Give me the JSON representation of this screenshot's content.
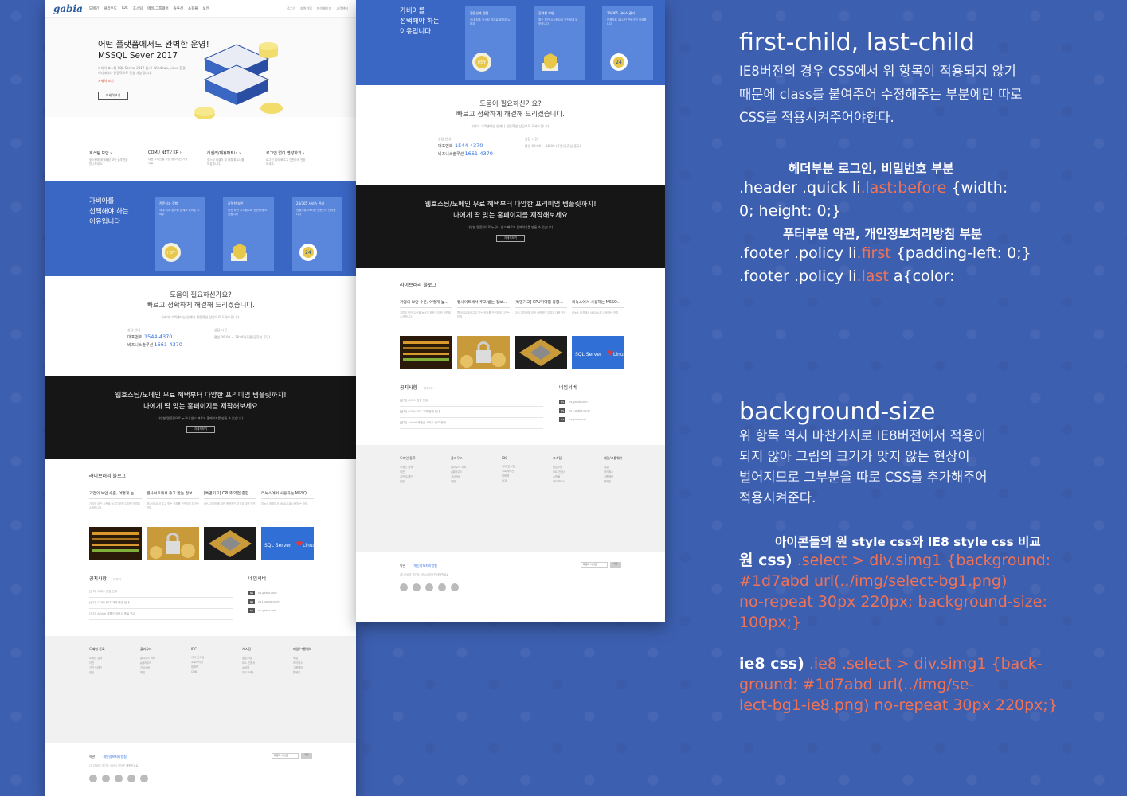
{
  "site": {
    "logo": "gabia",
    "nav": [
      "도메인",
      "클라우드",
      "IDC",
      "호스팅",
      "메일/그룹웨어",
      "솔루션",
      "쇼핑몰",
      "보안"
    ],
    "quick": [
      "로그인",
      "회원가입",
      "마이페이지",
      "고객센터"
    ]
  },
  "hero": {
    "title_line1": "어떤 플랫폼에서도 완벽한 운영!",
    "title_line2": "MSSQL Sever 2017",
    "desc": "가비아 호스팅 SQL Server 2017 출시! Windows, Linux 환경 어디에서나 안정적으로 운영 가능합니다.",
    "link": "자세히 보기",
    "button": "자세히보기"
  },
  "quickmenu": [
    {
      "title": "호스팅 보안 ›",
      "desc": "호스팅에 최적화된 보안 솔루션을 만나보세요."
    },
    {
      "title": "COM / NET / KR ›",
      "desc": "대표 도메인을 가장 합리적인 가격으로"
    },
    {
      "title": "리셀러/제휴파트너 ›",
      "desc": "호스팅 리셀러 및 제휴 파트너를 모집합니다."
    },
    {
      "title": "로그인 없이 연장하기 ›",
      "desc": "로그인 없이 빠르고 간편하게 연장하세요."
    }
  ],
  "why": {
    "title_line1": "가비아를",
    "title_line2": "선택해야 하는",
    "title_line3": "이유입니다",
    "cards": [
      {
        "title": "전문성과 경험",
        "desc": "국내 최초 호스팅 업체로 쌓아온 노하우",
        "icon": "HSY"
      },
      {
        "title": "강력한 보안",
        "desc": "최신 보안 시스템으로 안전하게 보호합니다",
        "icon": "shield"
      },
      {
        "title": "24/365 서비스 관리",
        "desc": "연중무휴 24시간 전문가가 관리합니다",
        "icon": "24"
      }
    ]
  },
  "help": {
    "title_line1": "도움이 필요하신가요?",
    "title_line2": "빠르고 정확하게 해결해 드리겠습니다.",
    "desc": "가비아 고객센터는 언제나 전문적인 상담으로 도와드립니다.",
    "label_center": "상담 안내",
    "main_label": "대표번호",
    "main_num": "1544-4370",
    "biz_label": "비즈니스솔루션",
    "biz_num": "1661-4370",
    "hours_label": "상담 시간",
    "hours": "평일 09:00 ~ 18:00 (주말/공휴일 휴무)"
  },
  "promo": {
    "title_line1": "웹호스팅/도메인 무료 혜택부터 다양한 프리미엄 템플릿까지!",
    "title_line2": "나에게 딱 맞는 홈페이지를 제작해보세요",
    "desc": "다양한 템플릿으로 누구나 쉽고 빠르게 홈페이지를 만들 수 있습니다.",
    "button": "자세히보기"
  },
  "library": {
    "title": "라이브러리 블로그",
    "items": [
      {
        "title": "기업의 보안 수준, 어떻게 높...",
        "desc": "기업의 보안 수준을 높이기 위한 다양한 방법을 소개합니다."
      },
      {
        "title": "웹사이트에서 주고 받는 정보...",
        "desc": "웹사이트에서 주고 받는 정보를 안전하게 지키는 방법."
      },
      {
        "title": "[특별기고] CPU취약점 종합...",
        "desc": "CPU 취약점에 대한 종합적인 분석과 대응 방안."
      },
      {
        "title": "리눅스에서 사용하는 MSSQ...",
        "desc": "리눅스 환경에서 MSSQL을 사용하는 방법."
      }
    ]
  },
  "notice": {
    "title": "공지사항",
    "more": "더보기 +",
    "rows": [
      "[공지] 서비스 점검 안내",
      "[공지] COM/.NET 가격 변경 안내",
      "[공지] Active 제품군 서비스 종료 안내"
    ]
  },
  "nameserver": {
    "title": "네임서버",
    "rows": [
      "ns.gabia.com",
      "ns1.gabia.co.kr",
      "ns.gabia.net"
    ]
  },
  "sitemap": [
    {
      "head": "도메인 등록",
      "items": [
        "도메인 검색",
        "이전",
        "기관 도메인",
        "연장"
      ]
    },
    {
      "head": "클라우드",
      "items": [
        "클라우드 서버",
        "g클라우드",
        "가상서버",
        "백업"
      ]
    },
    {
      "head": "IDC",
      "items": [
        "서버 호스팅",
        "코로케이션",
        "방화벽",
        "CDN"
      ]
    },
    {
      "head": "호스팅",
      "items": [
        "웹호스팅",
        "SSL 인증서",
        "쇼핑몰",
        "워드프레스"
      ]
    },
    {
      "head": "메일/그룹웨어",
      "items": [
        "메일",
        "하이웍스",
        "그룹웨어",
        "웹메일"
      ]
    }
  ],
  "footer": {
    "policy_first": "약관",
    "policy_last": "개인정보처리방침",
    "address": "(주)가비아 경기도 성남시 분당구 대왕판교로",
    "select": "패밀리 사이트",
    "select_btn": "이동"
  },
  "notes": {
    "heading1": "first-child, last-child",
    "para1_line1": "IE8버전의 경우 CSS에서 위 항목이 적용되지 않기",
    "para1_line2": "때문에 class를 붙여주어 수정해주는 부분에만 따로",
    "para1_line3": "CSS를 적용시켜주어야한다.",
    "sub1": "헤더부분 로그인, 비밀번호 부분",
    "code1_pre": ".header .quick li",
    "code1_hl": ".last:before",
    "code1_post_line1": " {width:",
    "code1_line2": "0; height: 0;}",
    "sub2": "푸터부분 약관, 개인정보처리방침 부분",
    "code2_pre": ".footer .policy li",
    "code2_hl": ".first",
    "code2_post": " {padding-left: 0;}",
    "code3_pre": ".footer .policy li",
    "code3_hl": ".last",
    "code3_post": " a{color:",
    "heading2": "background-size",
    "para2_line1": "위 항목 역시 마찬가지로 IE8버전에서 적용이",
    "para2_line2": "되지 않아 그림의 크기가 맞지 않는 현상이",
    "para2_line3": "벌어지므로 그부분을 따로 CSS를 추가해주어",
    "para2_line4": "적용시켜준다.",
    "sub3": "아이콘들의 원 style css와 IE8 style css 비교",
    "orig_label": "원 css)",
    "orig_line1": " .select > div.simg1 {background:",
    "orig_line2": "#1d7abd url(../img/select-bg1.png)",
    "orig_line3": "no-repeat 30px 220px; background-size:",
    "orig_line4": "100px;}",
    "ie8_label": "ie8 css)",
    "ie8_line1": " .ie8 .select > div.simg1 {back-",
    "ie8_line2": "ground: #1d7abd url(../img/se-",
    "ie8_line3": "lect-bg1-ie8.png) no-repeat 30px 220px;}"
  },
  "colors": {
    "background": "#3d5fb0",
    "accent_blue": "#3a66c4",
    "highlight": "#f07356"
  }
}
